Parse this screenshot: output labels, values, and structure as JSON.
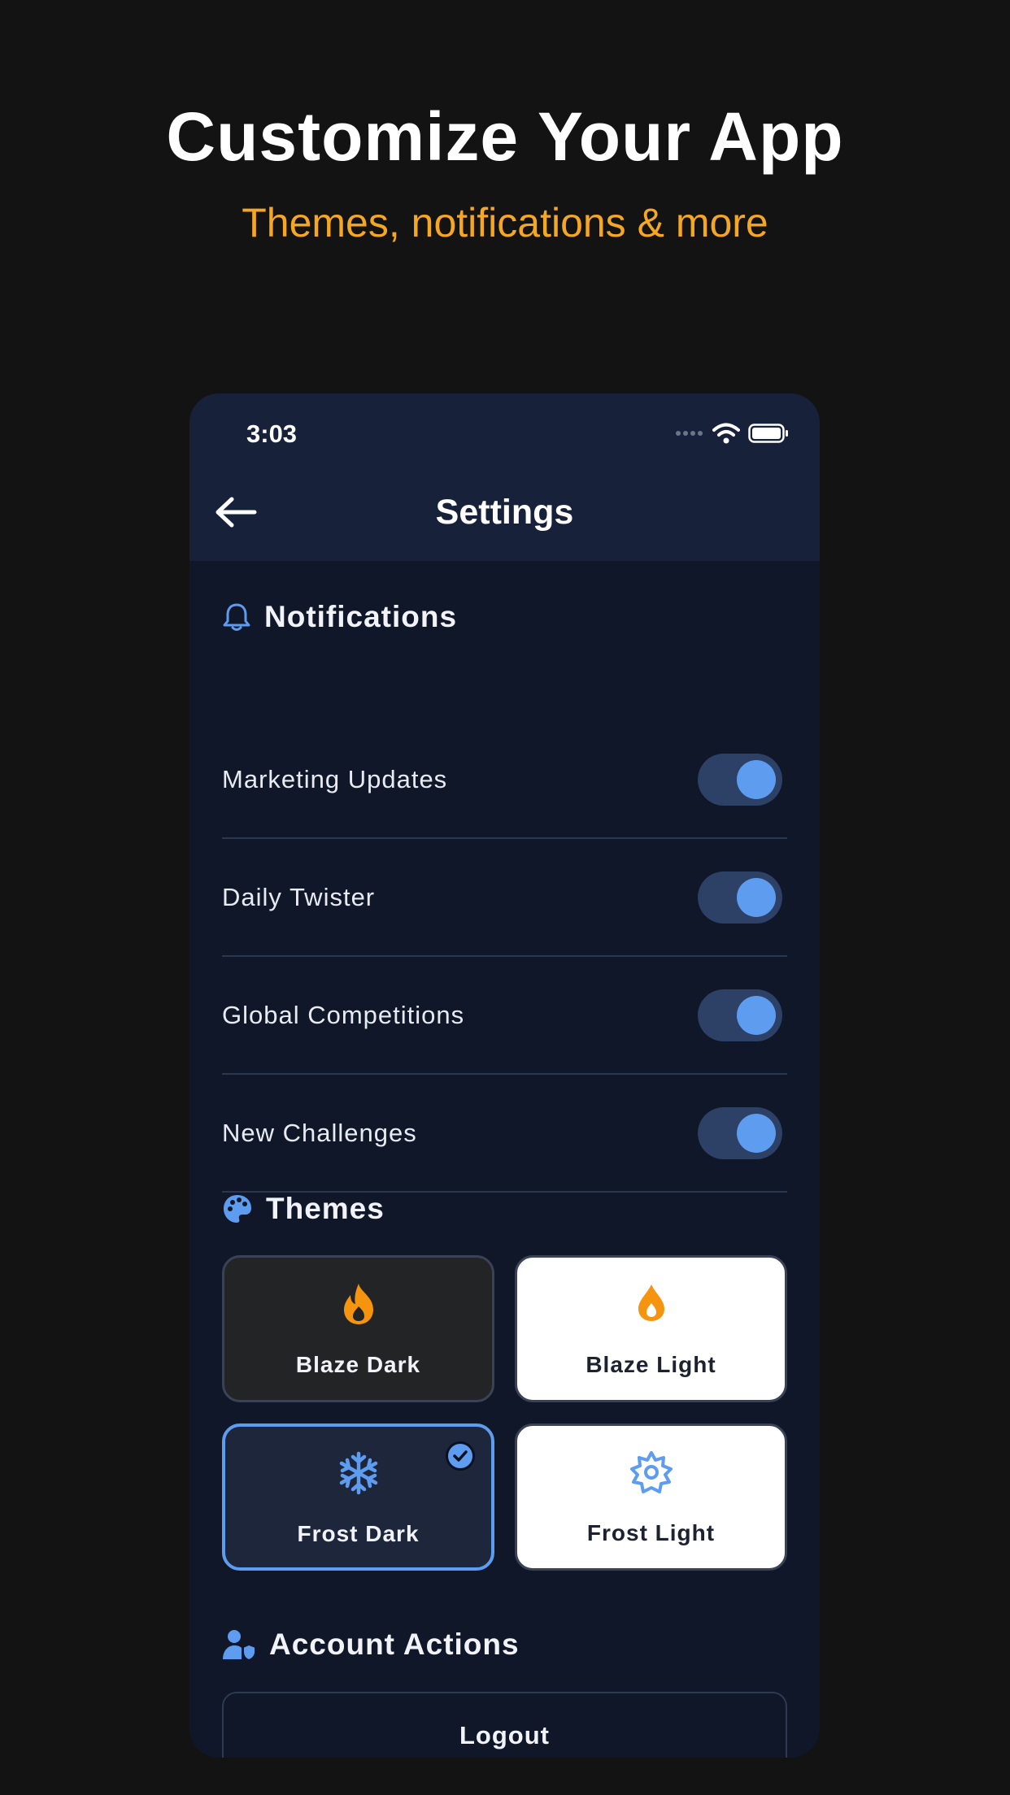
{
  "hero": {
    "title": "Customize Your App",
    "subtitle": "Themes, notifications & more"
  },
  "status_bar": {
    "time": "3:03",
    "icons": [
      "signal-dots-icon",
      "wifi-icon",
      "battery-icon"
    ]
  },
  "header": {
    "title": "Settings",
    "back_icon": "arrow-left-icon"
  },
  "notifications": {
    "heading": "Notifications",
    "icon": "bell-icon",
    "items": [
      {
        "label": "Marketing Updates",
        "enabled": true
      },
      {
        "label": "Daily Twister",
        "enabled": true
      },
      {
        "label": "Global Competitions",
        "enabled": true
      },
      {
        "label": "New Challenges",
        "enabled": true
      }
    ]
  },
  "themes": {
    "heading": "Themes",
    "icon": "palette-icon",
    "options": [
      {
        "label": "Blaze Dark",
        "icon": "flame-icon",
        "selected": false
      },
      {
        "label": "Blaze Light",
        "icon": "drop-flame-icon",
        "selected": false
      },
      {
        "label": "Frost Dark",
        "icon": "snowflake-icon",
        "selected": true
      },
      {
        "label": "Frost Light",
        "icon": "sun-gear-icon",
        "selected": false
      }
    ]
  },
  "account": {
    "heading": "Account Actions",
    "icon": "user-shield-icon",
    "logout_label": "Logout"
  },
  "colors": {
    "page_bg": "#131313",
    "accent": "#5e9cf0",
    "brand_orange": "#f5a623"
  }
}
